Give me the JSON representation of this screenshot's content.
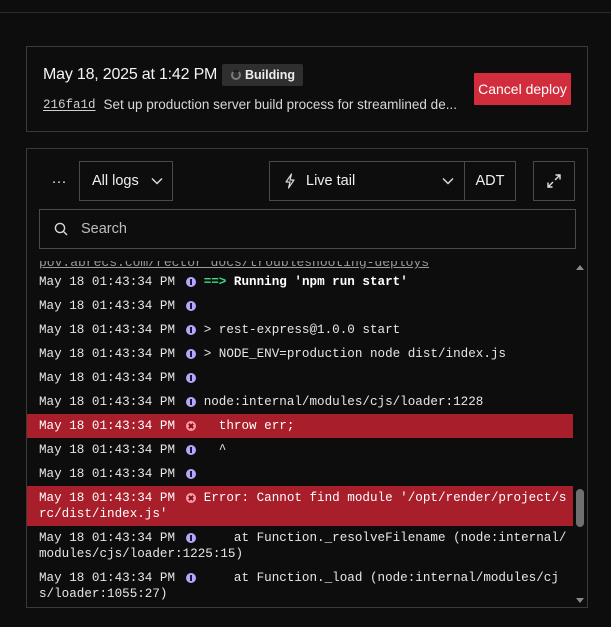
{
  "deploy": {
    "date": "May 18, 2025 at 1:42 PM",
    "status": "Building",
    "commit_hash": "216fa1d",
    "commit_message": "Set up production server build process for streamlined de...",
    "cancel_label": "Cancel deploy"
  },
  "logs_toolbar": {
    "more_label": "···",
    "filter_label": "All logs",
    "live_tail_label": "Live tail",
    "timezone_label": "ADT",
    "search_placeholder": "Search"
  },
  "log_truncated_line": "pov.abrecs.com/rector_docs/troubleshooting-deploys",
  "log_entries": [
    {
      "timestamp": "May 18 01:43:34 PM",
      "level": "info",
      "message": "==> Running 'npm run start'"
    },
    {
      "timestamp": "May 18 01:43:34 PM",
      "level": "info",
      "message": ""
    },
    {
      "timestamp": "May 18 01:43:34 PM",
      "level": "info",
      "message": "> rest-express@1.0.0 start"
    },
    {
      "timestamp": "May 18 01:43:34 PM",
      "level": "info",
      "message": "> NODE_ENV=production node dist/index.js"
    },
    {
      "timestamp": "May 18 01:43:34 PM",
      "level": "info",
      "message": ""
    },
    {
      "timestamp": "May 18 01:43:34 PM",
      "level": "info",
      "message": "node:internal/modules/cjs/loader:1228"
    },
    {
      "timestamp": "May 18 01:43:34 PM",
      "level": "error",
      "message": "  throw err;"
    },
    {
      "timestamp": "May 18 01:43:34 PM",
      "level": "info",
      "message": "  ^"
    },
    {
      "timestamp": "May 18 01:43:34 PM",
      "level": "info",
      "message": ""
    },
    {
      "timestamp": "May 18 01:43:34 PM",
      "level": "error",
      "message": "Error: Cannot find module '/opt/render/project/src/dist/index.js'"
    },
    {
      "timestamp": "May 18 01:43:34 PM",
      "level": "info",
      "message": "    at Function._resolveFilename (node:internal/modules/cjs/loader:1225:15)"
    },
    {
      "timestamp": "May 18 01:43:34 PM",
      "level": "info",
      "message": "    at Function._load (node:internal/modules/cjs/loader:1055:27)"
    }
  ],
  "colors": {
    "error_row": "#a81e2a",
    "cancel_button": "#d12d3d",
    "info_icon": "#b7a6ff",
    "prompt_arrow": "#3ddc84"
  }
}
